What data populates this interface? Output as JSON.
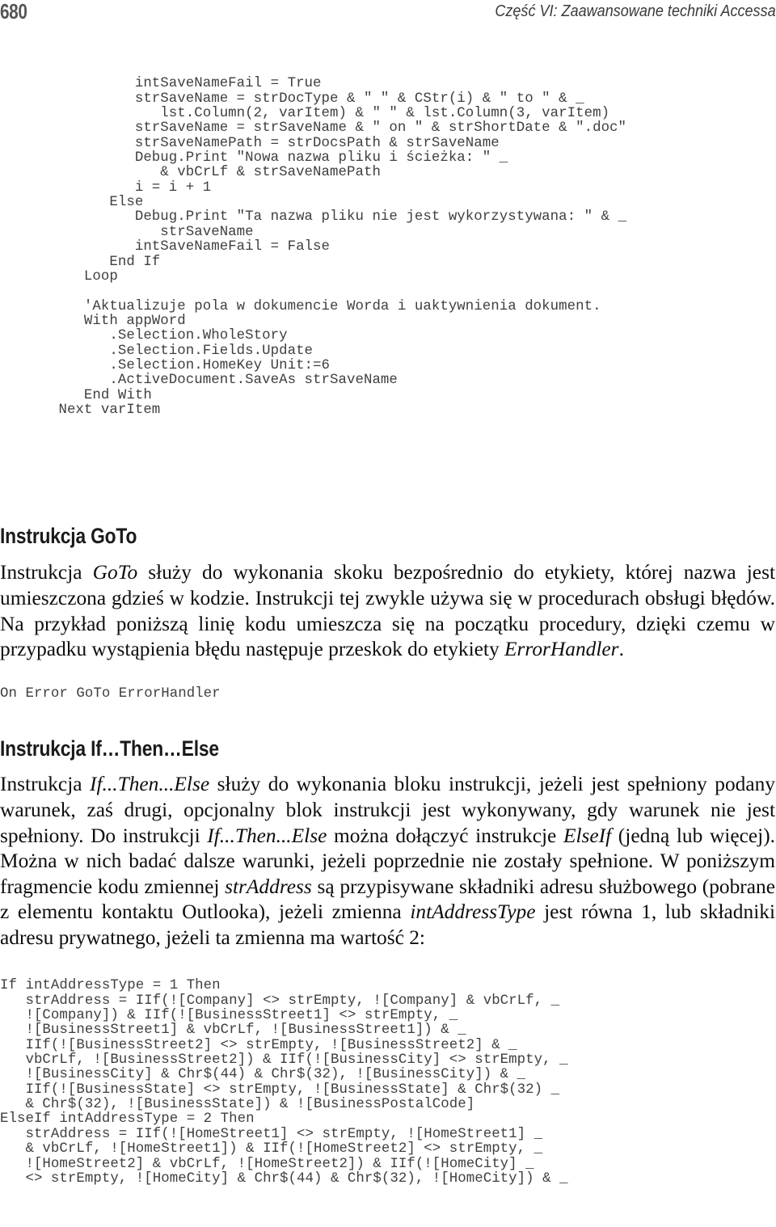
{
  "page": {
    "folio": "680",
    "running_head": "Część VI: Zaawansowane techniki Accessa"
  },
  "code_blocks": {
    "save_name_loop": "            intSaveNameFail = True\n            strSaveName = strDocType & \" \" & CStr(i) & \" to \" & _\n               lst.Column(2, varItem) & \" \" & lst.Column(3, varItem)\n            strSaveName = strSaveName & \" on \" & strShortDate & \".doc\"\n            strSaveNamePath = strDocsPath & strSaveName\n            Debug.Print \"Nowa nazwa pliku i ścieżka: \" _\n               & vbCrLf & strSaveNamePath\n            i = i + 1\n         Else\n            Debug.Print \"Ta nazwa pliku nie jest wykorzystywana: \" & _\n               strSaveName\n            intSaveNameFail = False\n         End If\n      Loop\n\n      'Aktualizuje pola w dokumencie Worda i uaktywnienia dokument.\n      With appWord\n         .Selection.WholeStory\n         .Selection.Fields.Update\n         .Selection.HomeKey Unit:=6\n         .ActiveDocument.SaveAs strSaveName\n      End With\n   Next varItem",
    "on_error_goto": "On Error GoTo ErrorHandler",
    "if_then_else_address": "If intAddressType = 1 Then\n   strAddress = IIf(![Company] <> strEmpty, ![Company] & vbCrLf, _\n   ![Company]) & IIf(![BusinessStreet1] <> strEmpty, _\n   ![BusinessStreet1] & vbCrLf, ![BusinessStreet1]) & _\n   IIf(![BusinessStreet2] <> strEmpty, ![BusinessStreet2] & _\n   vbCrLf, ![BusinessStreet2]) & IIf(![BusinessCity] <> strEmpty, _\n   ![BusinessCity] & Chr$(44) & Chr$(32), ![BusinessCity]) & _\n   IIf(![BusinessState] <> strEmpty, ![BusinessState] & Chr$(32) _\n   & Chr$(32), ![BusinessState]) & ![BusinessPostalCode]\nElseIf intAddressType = 2 Then\n   strAddress = IIf(![HomeStreet1] <> strEmpty, ![HomeStreet1] _\n   & vbCrLf, ![HomeStreet1]) & IIf(![HomeStreet2] <> strEmpty, _\n   ![HomeStreet2] & vbCrLf, ![HomeStreet2]) & IIf(![HomeCity] _\n   <> strEmpty, ![HomeCity] & Chr$(44) & Chr$(32), ![HomeCity]) & _"
  },
  "sections": [
    {
      "heading": "Instrukcja GoTo",
      "paragraph_html": "Instrukcja <i>GoTo</i> służy do wykonania skoku bezpośrednio do etykiety, której nazwa jest umieszczona gdzieś w kodzie. Instrukcji tej zwykle używa się w procedurach obsługi błędów. Na przykład poniższą linię kodu umieszcza się na początku procedury, dzięki czemu w przypadku wystąpienia błędu następuje przeskok do etykiety <i>ErrorHandler</i>."
    },
    {
      "heading": "Instrukcja If…Then…Else",
      "paragraph_html": "Instrukcja <i>If...Then...Else</i> służy do wykonania bloku instrukcji, jeżeli jest spełniony podany warunek, zaś drugi, opcjonalny blok instrukcji jest wykonywany, gdy warunek nie jest spełniony. Do instrukcji <i>If...Then...Else</i> można dołączyć instrukcje <i>ElseIf</i> (jedną lub więcej). Można w nich badać dalsze warunki, jeżeli poprzednie nie zostały spełnione. W poniższym fragmencie kodu zmiennej <i>strAddress</i> są przypisywane składniki adresu służbowego (pobrane z elementu kontaktu Outlooka), jeżeli zmienna <i>intAddressType</i> jest równa 1, lub składniki adresu prywatnego, jeżeli ta zmienna ma wartość 2:"
    }
  ],
  "colors": {
    "code_text": "#3f3f3f",
    "body_text": "#0d0d0d",
    "folio": "#565656",
    "running_head": "#3a3a3a",
    "page_background": "#ffffff"
  }
}
